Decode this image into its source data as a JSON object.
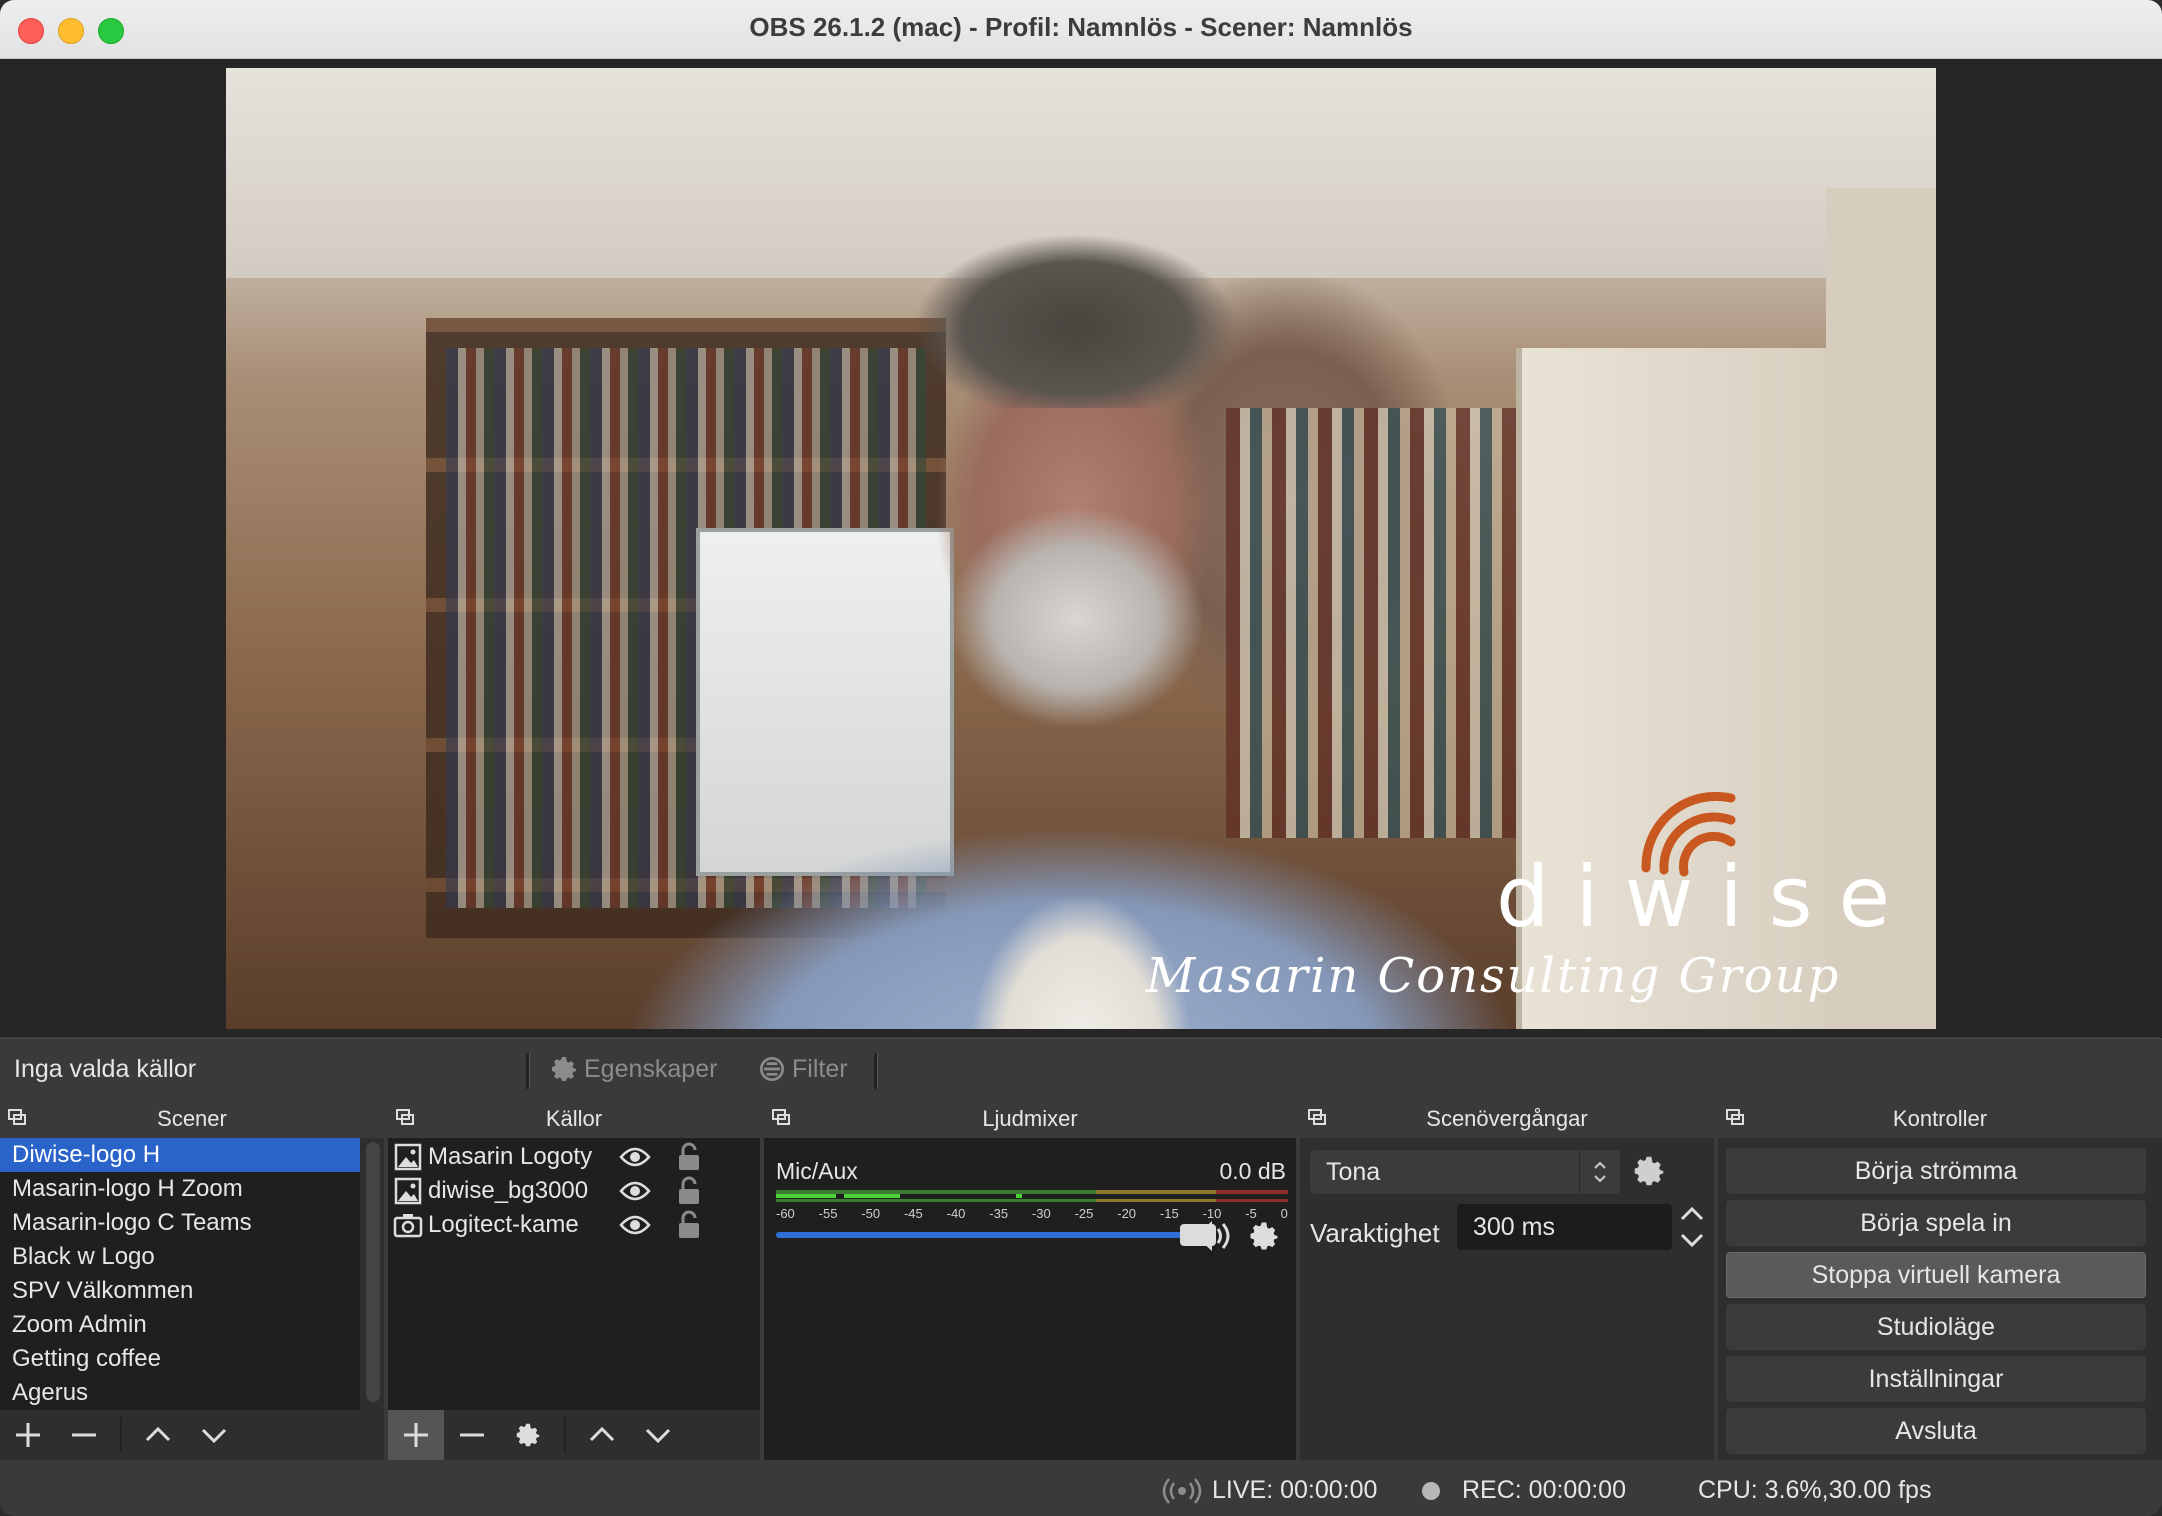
{
  "window": {
    "title": "OBS 26.1.2 (mac) - Profil: Namnlös - Scener: Namnlös"
  },
  "preview": {
    "logo_word": "diwise",
    "logo_script": "Masarin Consulting Group"
  },
  "context_bar": {
    "no_source_text": "Inga valda källor",
    "properties_label": "Egenskaper",
    "filters_label": "Filter"
  },
  "scenes": {
    "title": "Scener",
    "items": [
      {
        "label": "Diwise-logo H",
        "selected": true
      },
      {
        "label": "Masarin-logo H Zoom",
        "selected": false
      },
      {
        "label": "Masarin-logo C Teams",
        "selected": false
      },
      {
        "label": "Black w Logo",
        "selected": false
      },
      {
        "label": "SPV Välkommen",
        "selected": false
      },
      {
        "label": "Zoom Admin",
        "selected": false
      },
      {
        "label": "Getting coffee",
        "selected": false
      },
      {
        "label": "Agerus",
        "selected": false
      }
    ]
  },
  "sources": {
    "title": "Källor",
    "items": [
      {
        "label": "Masarin Logoty",
        "icon": "image-icon"
      },
      {
        "label": "diwise_bg3000",
        "icon": "image-icon"
      },
      {
        "label": "Logitect-kame",
        "icon": "camera-icon"
      }
    ]
  },
  "mixer": {
    "title": "Ljudmixer",
    "channel": "Mic/Aux",
    "level": "0.0 dB",
    "ticks": [
      "-60",
      "-55",
      "-50",
      "-45",
      "-40",
      "-35",
      "-30",
      "-25",
      "-20",
      "-15",
      "-10",
      "-5",
      "0"
    ],
    "volume_fraction": 1.0
  },
  "transitions": {
    "title": "Scenövergångar",
    "selected": "Tona",
    "duration_label": "Varaktighet",
    "duration_value": "300 ms"
  },
  "controls": {
    "title": "Kontroller",
    "buttons": [
      {
        "label": "Börja strömma",
        "active": false
      },
      {
        "label": "Börja spela in",
        "active": false
      },
      {
        "label": "Stoppa virtuell kamera",
        "active": true
      },
      {
        "label": "Studioläge",
        "active": false
      },
      {
        "label": "Inställningar",
        "active": false
      },
      {
        "label": "Avsluta",
        "active": false
      }
    ]
  },
  "status": {
    "live": "LIVE: 00:00:00",
    "rec": "REC: 00:00:00",
    "cpu": "CPU: 3.6%,30.00 fps"
  },
  "colors": {
    "selection": "#2a63c9",
    "meter_green": "#4cd137",
    "meter_yellow": "#e3c33a",
    "meter_red": "#d9453b",
    "logo_orange": "#c8581f"
  }
}
